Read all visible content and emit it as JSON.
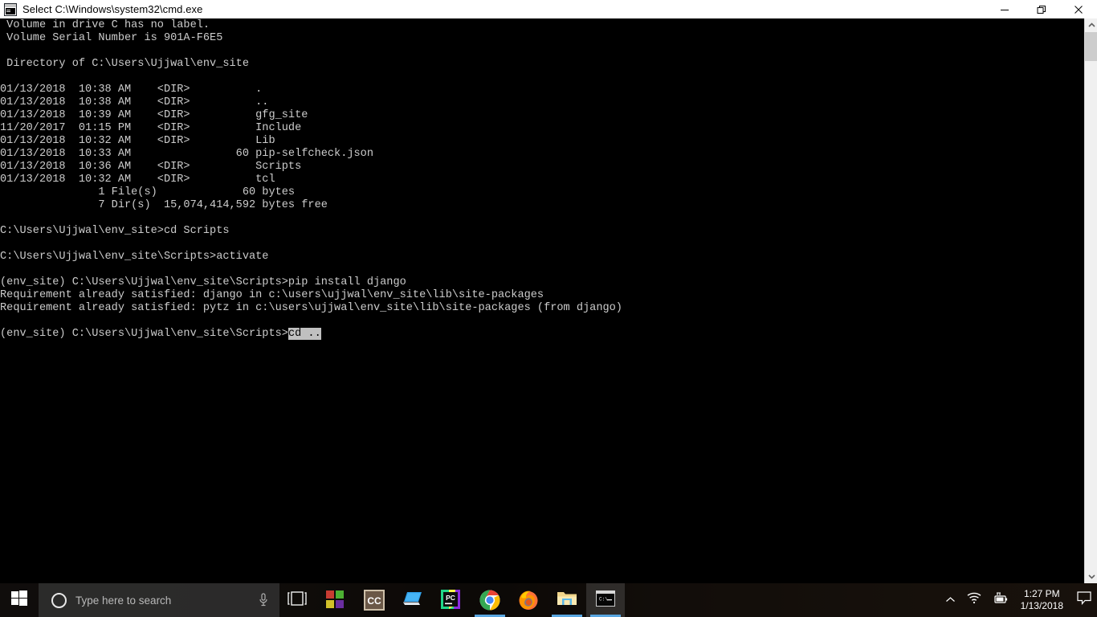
{
  "window": {
    "title": "Select C:\\Windows\\system32\\cmd.exe",
    "icon": "cmd-console-icon",
    "controls": [
      {
        "name": "minimize-button",
        "glyph": "minimize-icon"
      },
      {
        "name": "restore-button",
        "glyph": "restore-icon"
      },
      {
        "name": "close-button",
        "glyph": "close-icon"
      }
    ]
  },
  "console": {
    "lines": [
      " Volume in drive C has no label.",
      " Volume Serial Number is 901A-F6E5",
      "",
      " Directory of C:\\Users\\Ujjwal\\env_site",
      "",
      "01/13/2018  10:38 AM    <DIR>          .",
      "01/13/2018  10:38 AM    <DIR>          ..",
      "01/13/2018  10:39 AM    <DIR>          gfg_site",
      "11/20/2017  01:15 PM    <DIR>          Include",
      "01/13/2018  10:32 AM    <DIR>          Lib",
      "01/13/2018  10:33 AM                60 pip-selfcheck.json",
      "01/13/2018  10:36 AM    <DIR>          Scripts",
      "01/13/2018  10:32 AM    <DIR>          tcl",
      "               1 File(s)             60 bytes",
      "               7 Dir(s)  15,074,414,592 bytes free",
      "",
      "C:\\Users\\Ujjwal\\env_site>cd Scripts",
      "",
      "C:\\Users\\Ujjwal\\env_site\\Scripts>activate",
      "",
      "(env_site) C:\\Users\\Ujjwal\\env_site\\Scripts>pip install django",
      "Requirement already satisfied: django in c:\\users\\ujjwal\\env_site\\lib\\site-packages",
      "Requirement already satisfied: pytz in c:\\users\\ujjwal\\env_site\\lib\\site-packages (from django)",
      ""
    ],
    "last_prompt": "(env_site) C:\\Users\\Ujjwal\\env_site\\Scripts>",
    "selected_text": "cd ..",
    "text_color": "#cccccc",
    "background_color": "#000000",
    "selection_background": "#c0c0c0",
    "selection_color": "#000000"
  },
  "scrollbar": {
    "up_arrow": "chevron-up-icon",
    "down_arrow": "chevron-down-icon",
    "thumb_position_percent": 2
  },
  "taskbar": {
    "start": {
      "name": "start-button",
      "icon": "windows-logo-icon"
    },
    "search": {
      "placeholder": "Type here to search",
      "cortana_icon": "cortana-circle-icon",
      "mic_icon": "microphone-icon"
    },
    "task_view": {
      "name": "task-view-button",
      "icon": "task-view-icon"
    },
    "apps": [
      {
        "name": "taskbar-item-microsoft-store",
        "icon": "microsoft-store-icon",
        "active": false,
        "running": false
      },
      {
        "name": "taskbar-item-cc",
        "icon": "cc-icon",
        "active": false,
        "running": false
      },
      {
        "name": "taskbar-item-laptop",
        "icon": "laptop-icon",
        "active": false,
        "running": false
      },
      {
        "name": "taskbar-item-pycharm",
        "icon": "pycharm-icon",
        "active": false,
        "running": false
      },
      {
        "name": "taskbar-item-chrome",
        "icon": "chrome-icon",
        "active": false,
        "running": true
      },
      {
        "name": "taskbar-item-firefox",
        "icon": "firefox-icon",
        "active": false,
        "running": false
      },
      {
        "name": "taskbar-item-file-explorer",
        "icon": "file-explorer-icon",
        "active": false,
        "running": true
      },
      {
        "name": "taskbar-item-command-prompt",
        "icon": "cmd-console-icon",
        "active": true,
        "running": true
      }
    ],
    "tray": {
      "show_hidden_icons": "chevron-up-icon",
      "network": "wifi-icon",
      "battery": "battery-charging-icon",
      "time": "1:27 PM",
      "date": "1/13/2018",
      "action_center": "action-center-icon"
    },
    "accent_color": "#59a6e0"
  }
}
